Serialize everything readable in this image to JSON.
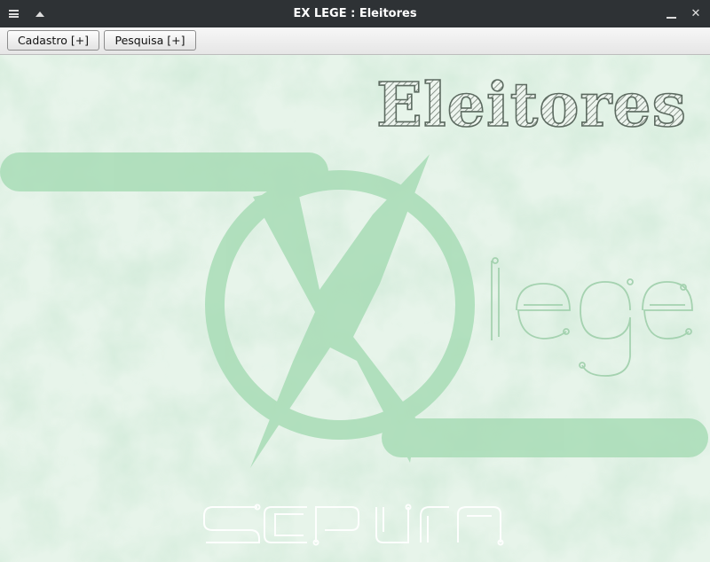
{
  "window": {
    "title": "EX LEGE : Eleitores",
    "menu_icon": "hamburger-menu-icon",
    "shade_icon": "shade-up-icon",
    "minimize_icon": "minimize-icon",
    "close_icon": "close-icon",
    "close_glyph": "✕"
  },
  "toolbar": {
    "cadastro_label": "Cadastro [+]",
    "pesquisa_label": "Pesquisa [+]"
  },
  "background": {
    "heading": "Eleitores",
    "logo_word": "lege",
    "footer_text": "SCP URN",
    "accent_color": "#a8dcb6",
    "bg_color": "#e9f5ec"
  }
}
